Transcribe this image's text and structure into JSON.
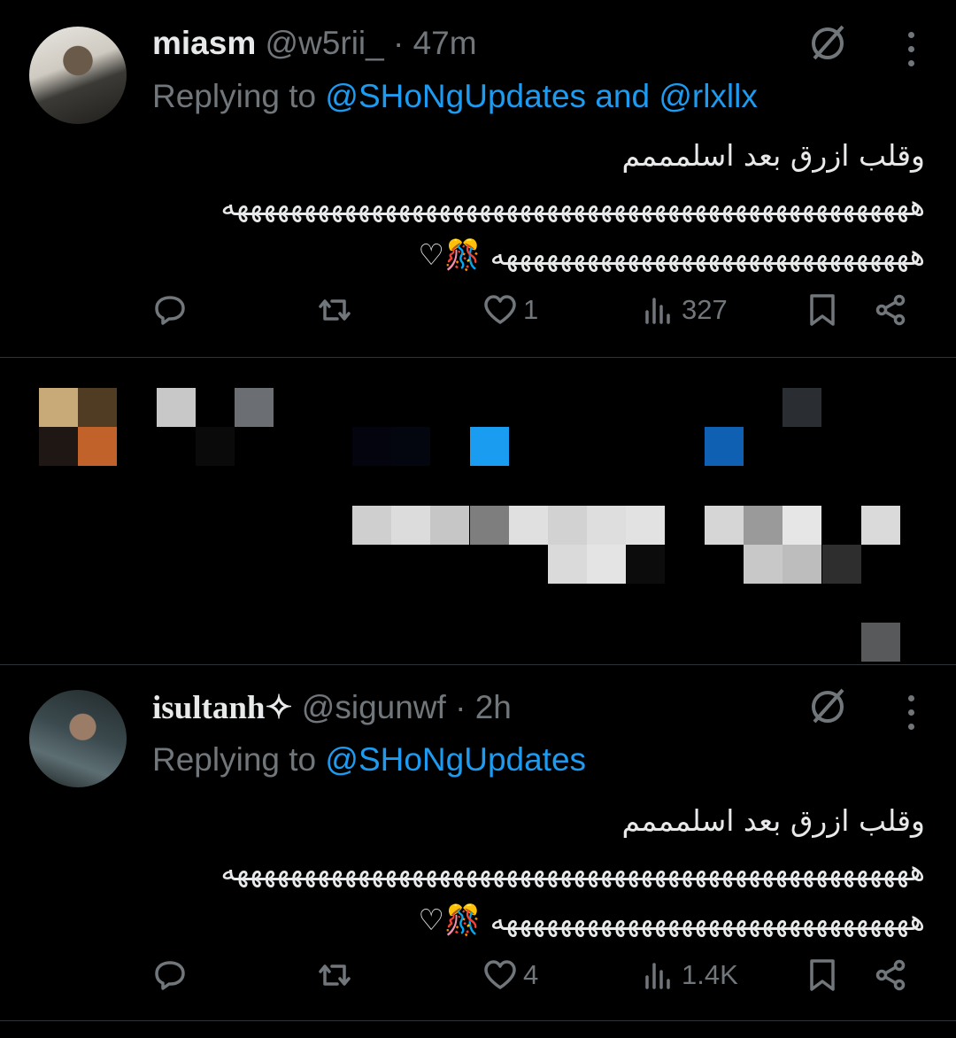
{
  "tweets": [
    {
      "name": "miasm",
      "handle": "@w5rii_",
      "time": "· 47m",
      "replying_prefix": "Replying to ",
      "replying_to": "@SHoNgUpdates and @rlxllx",
      "text_line1": "وقلب ازرق بعد اسلمممم",
      "text_line2": "هههههههههههههههههههههههههههههههههههههههههههههههههههه",
      "text_line3": "هههههههههههههههههههههههههههههههه 🎊♡",
      "likes": "1",
      "views": "327"
    },
    {
      "name": "isultanh✧",
      "handle": "@sigunwf",
      "time": "· 2h",
      "replying_prefix": "Replying to ",
      "replying_to": "@SHoNgUpdates",
      "text_line1": "وقلب ازرق بعد اسلمممم",
      "text_line2": "هههههههههههههههههههههههههههههههههههههههههههههههههههه",
      "text_line3": "هههههههههههههههههههههههههههههههه 🎊♡",
      "likes": "4",
      "views": "1.4K"
    }
  ],
  "icons": {
    "reply": "reply-icon",
    "retweet": "retweet-icon",
    "like": "heart-icon",
    "views": "views-icon",
    "bookmark": "bookmark-icon",
    "share": "share-icon",
    "grok": "grok-icon",
    "more": "more-icon"
  },
  "colors": {
    "background": "#000000",
    "text": "#e7e9ea",
    "muted": "#71767b",
    "link": "#1d9bf0",
    "divider": "#2f3336"
  }
}
